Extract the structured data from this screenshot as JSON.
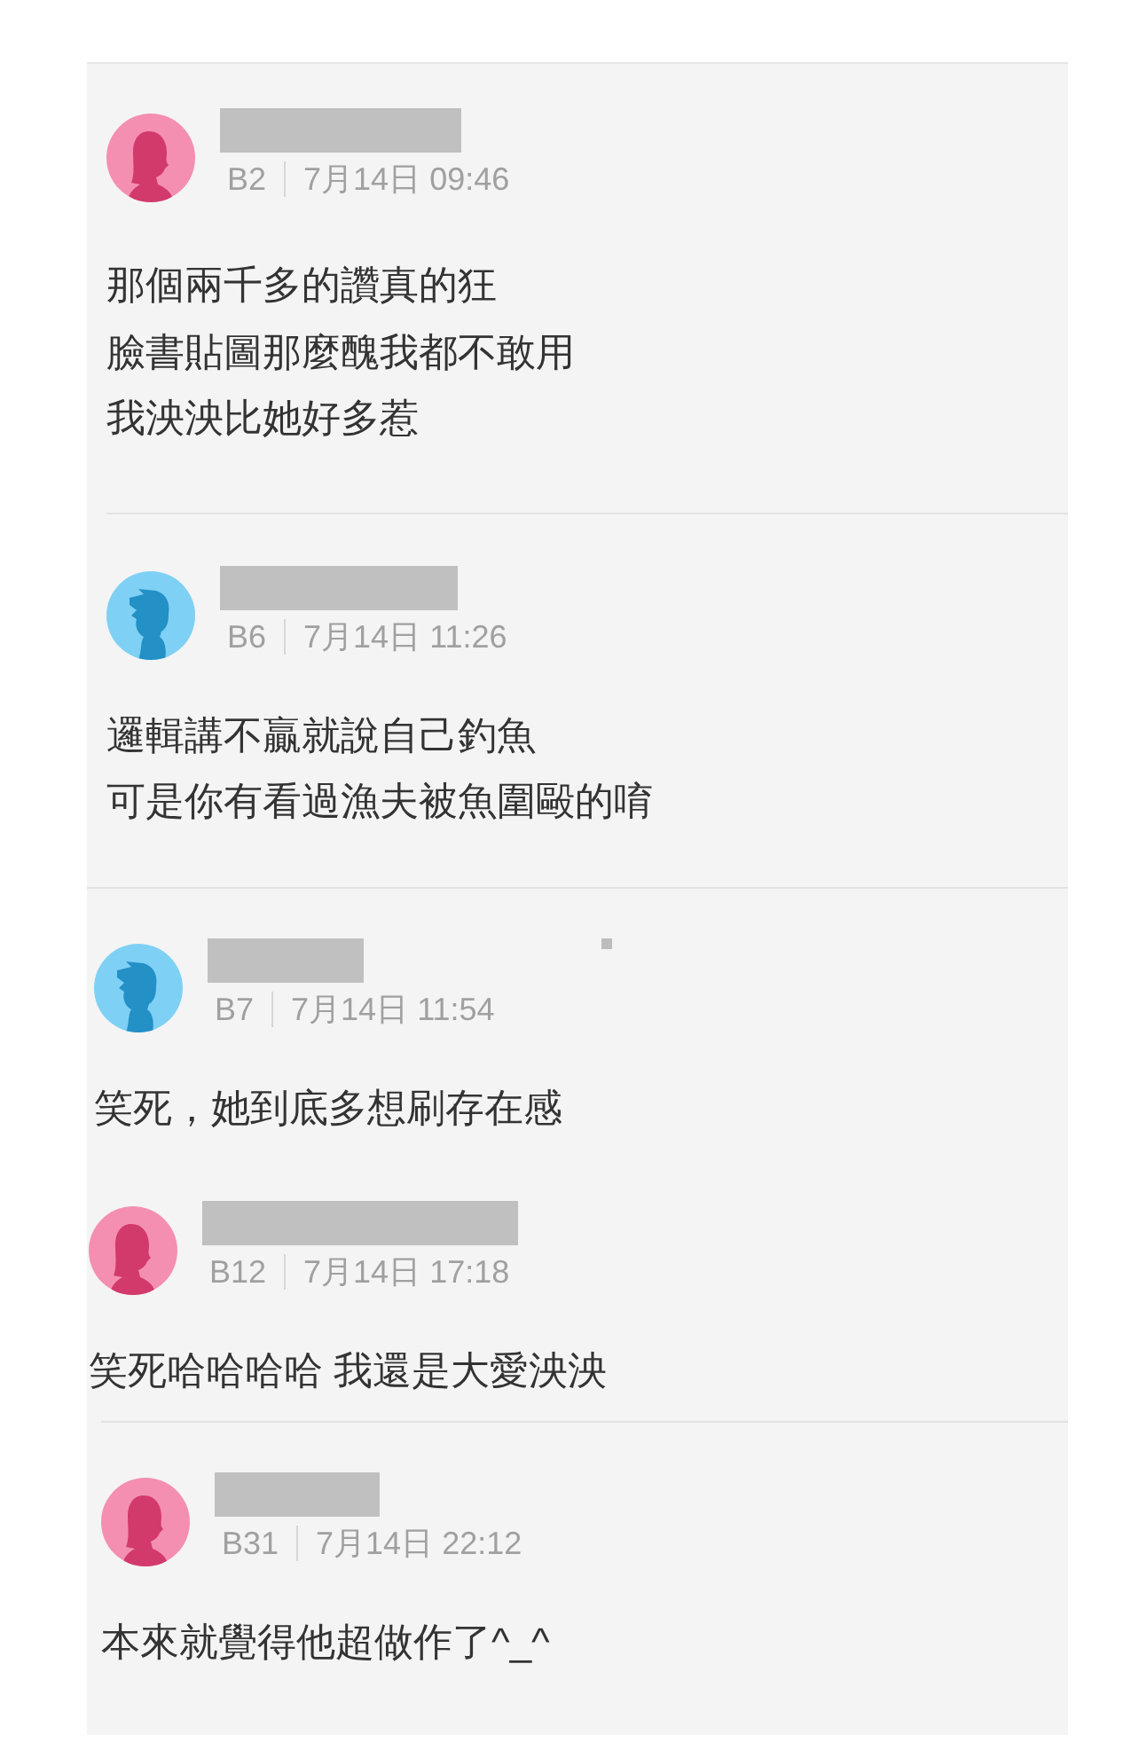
{
  "comments": [
    {
      "kind": "female",
      "floor": "B2",
      "time": "7月14日 09:46",
      "lines": [
        "那個兩千多的讚真的狂",
        "臉書貼圖那麼醜我都不敢用",
        "我泱泱比她好多惹"
      ],
      "marker": false
    },
    {
      "kind": "male",
      "floor": "B6",
      "time": "7月14日 11:26",
      "lines": [
        "邏輯講不贏就說自己釣魚",
        "可是你有看過漁夫被魚圍毆的唷"
      ],
      "marker": false
    },
    {
      "kind": "male",
      "floor": "B7",
      "time": "7月14日 11:54",
      "lines": [
        "笑死，她到底多想刷存在感"
      ],
      "marker": true
    },
    {
      "kind": "female",
      "floor": "B12",
      "time": "7月14日 17:18",
      "lines": [
        "笑死哈哈哈哈 我還是大愛泱泱"
      ],
      "marker": false
    },
    {
      "kind": "female",
      "floor": "B31",
      "time": "7月14日 22:12",
      "lines": [
        "本來就覺得他超做作了^_^"
      ],
      "marker": false
    }
  ]
}
